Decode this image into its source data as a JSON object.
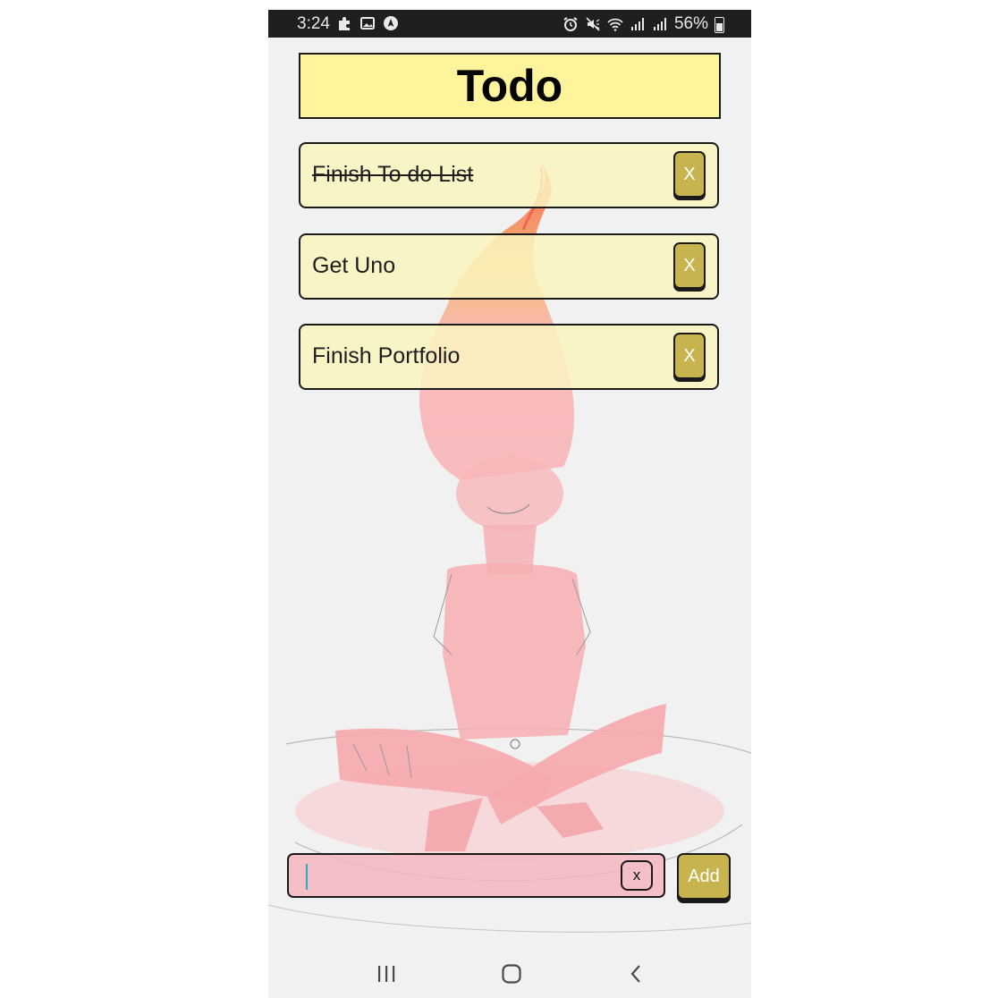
{
  "status_bar": {
    "time": "3:24",
    "left_icons": [
      "puzzle-icon",
      "image-icon",
      "navigation-icon"
    ],
    "right_icons": [
      "alarm-icon",
      "mute-icon",
      "wifi-icon",
      "signal-icon",
      "signal-icon"
    ],
    "battery_percent": "56%"
  },
  "header": {
    "title": "Todo",
    "background": "#fdf49c"
  },
  "todos": [
    {
      "label": "Finish To do List",
      "completed": true,
      "delete_label": "X"
    },
    {
      "label": "Get Uno",
      "completed": false,
      "delete_label": "X"
    },
    {
      "label": "Finish Portfolio",
      "completed": false,
      "delete_label": "X"
    }
  ],
  "new_todo": {
    "value": "",
    "placeholder": "",
    "clear_label": "x",
    "add_label": "Add"
  },
  "nav_bar": {
    "buttons": [
      "recent-apps-icon",
      "home-icon",
      "back-icon"
    ]
  },
  "colors": {
    "accent": "#c7b44f",
    "item_background": "#f8f3bd",
    "input_background": "#f6b6c1"
  }
}
